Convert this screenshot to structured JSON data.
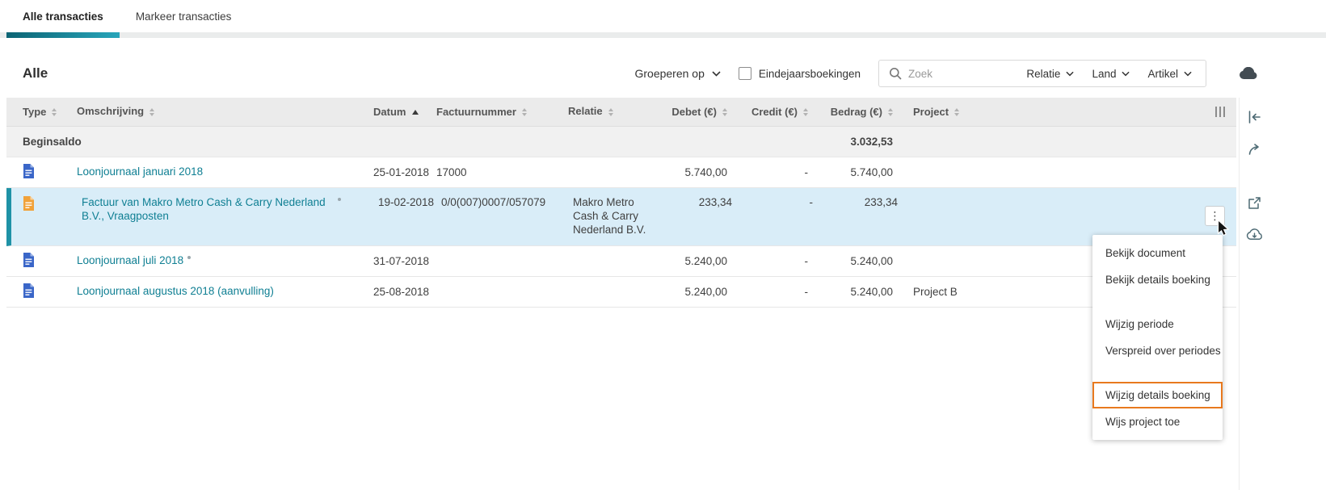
{
  "colors": {
    "accent_teal": "#1f92a6",
    "tab_underline_gradient": [
      "#0c6474",
      "#28a5ba"
    ],
    "link": "#0f7f93",
    "selected_row_background": "#d9edf8",
    "menu_highlight_border": "#e8791e",
    "header_background": "#ebebeb",
    "journal_icon_blue": "#3a66c8",
    "invoice_icon_orange": "#f1a23a"
  },
  "tabs": [
    {
      "label": "Alle transacties",
      "active": true
    },
    {
      "label": "Markeer transacties",
      "active": false
    }
  ],
  "toolbar": {
    "title": "Alle",
    "group_by_label": "Groeperen op",
    "year_end_checkbox_label": "Eindejaarsboekingen",
    "year_end_checked": false,
    "search_placeholder": "Zoek",
    "filters": [
      {
        "label": "Relatie"
      },
      {
        "label": "Land"
      },
      {
        "label": "Artikel"
      }
    ]
  },
  "table": {
    "columns": [
      {
        "label": "Type"
      },
      {
        "label": "Omschrijving"
      },
      {
        "label": "Datum",
        "sorted": "asc"
      },
      {
        "label": "Factuurnummer"
      },
      {
        "label": "Relatie"
      },
      {
        "label": "Debet (€)"
      },
      {
        "label": "Credit (€)"
      },
      {
        "label": "Bedrag (€)"
      },
      {
        "label": "Project"
      }
    ],
    "opening_balance": {
      "label": "Beginsaldo",
      "bedrag": "3.032,53"
    },
    "rows": [
      {
        "icon": "journal-doc-blue",
        "omschrijving": "Loonjournaal januari 2018",
        "datum": "25-01-2018",
        "factuurnummer": "17000",
        "relatie": "",
        "debet": "5.740,00",
        "credit": "-",
        "bedrag": "5.740,00",
        "project": ""
      },
      {
        "icon": "invoice-doc-orange",
        "omschrijving": "Factuur van Makro Metro Cash & Carry Nederland B.V., Vraagposten",
        "datum": "19-02-2018",
        "factuurnummer": "0/0(007)0007/057079",
        "relatie": "Makro Metro Cash & Carry Nederland B.V.",
        "debet": "233,34",
        "credit": "-",
        "bedrag": "233,34",
        "project": "",
        "selected": true
      },
      {
        "icon": "journal-doc-blue",
        "omschrijving": "Loonjournaal juli 2018",
        "datum": "31-07-2018",
        "factuurnummer": "",
        "relatie": "",
        "debet": "5.240,00",
        "credit": "-",
        "bedrag": "5.240,00",
        "project": ""
      },
      {
        "icon": "journal-doc-blue",
        "omschrijving": "Loonjournaal augustus 2018 (aanvulling)",
        "datum": "25-08-2018",
        "factuurnummer": "",
        "relatie": "",
        "debet": "5.240,00",
        "credit": "-",
        "bedrag": "5.240,00",
        "project": "Project B"
      }
    ]
  },
  "context_menu": {
    "items": [
      {
        "label": "Bekijk document",
        "highlighted": false
      },
      {
        "label": "Bekijk details boeking",
        "highlighted": false
      },
      {
        "label": "Wijzig periode",
        "highlighted": false
      },
      {
        "label": "Verspreid over periodes",
        "highlighted": false
      },
      {
        "label": "Wijzig details boeking",
        "highlighted": true
      },
      {
        "label": "Wijs project toe",
        "highlighted": false
      }
    ]
  },
  "icons": {
    "kebab": "⋮"
  }
}
